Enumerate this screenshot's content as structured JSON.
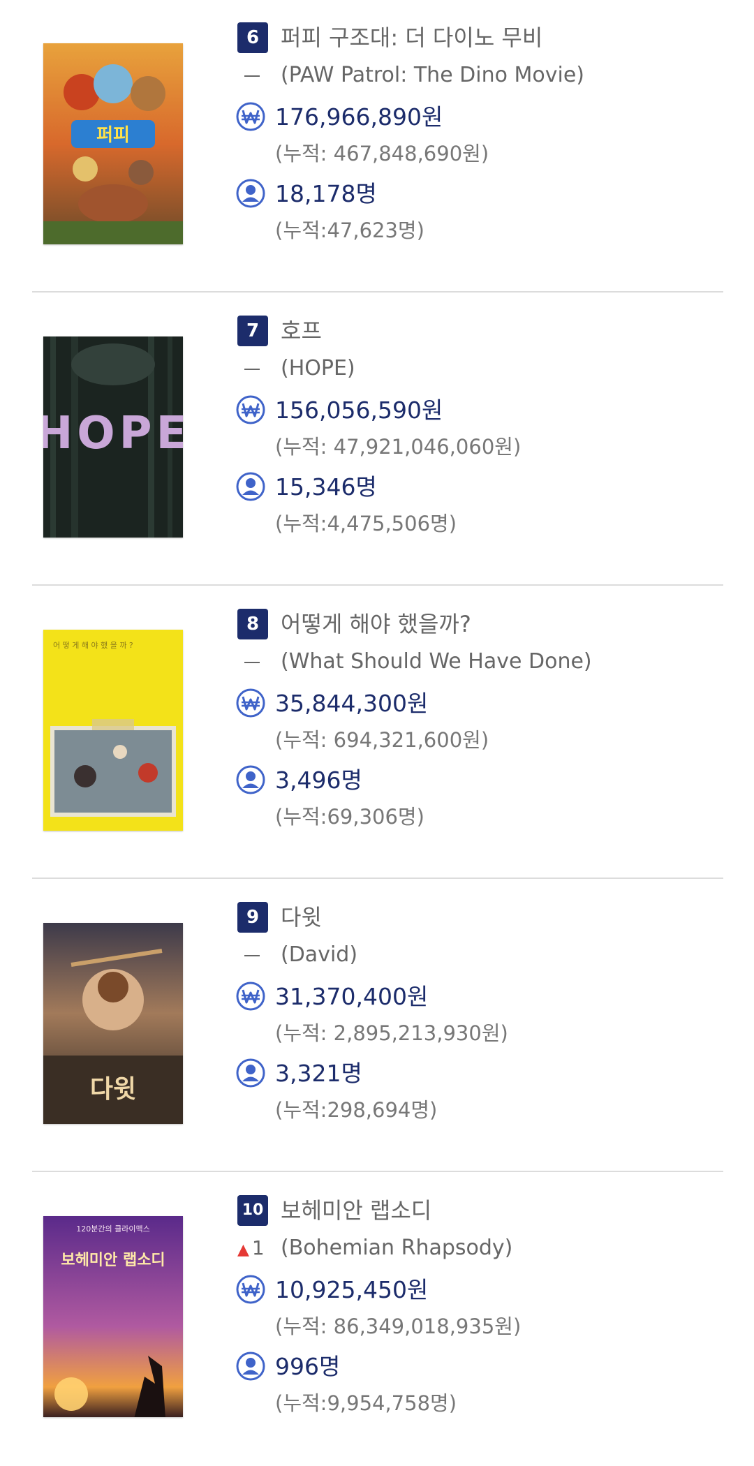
{
  "movies": [
    {
      "rank": "6",
      "title": "퍼피 구조대: 더 다이노 무비",
      "original_title": "(PAW Patrol: The Dino Movie)",
      "rank_change": {
        "type": "same",
        "value": ""
      },
      "sales": "176,966,890원",
      "sales_cumulative": "(누적: 467,848,690원)",
      "audience": "18,178명",
      "audience_cumulative": "(누적:47,623명)",
      "poster_text": "퍼피"
    },
    {
      "rank": "7",
      "title": "호프",
      "original_title": "(HOPE)",
      "rank_change": {
        "type": "same",
        "value": ""
      },
      "sales": "156,056,590원",
      "sales_cumulative": "(누적: 47,921,046,060원)",
      "audience": "15,346명",
      "audience_cumulative": "(누적:4,475,506명)",
      "poster_text": "HOPE"
    },
    {
      "rank": "8",
      "title": "어떻게 해야 했을까?",
      "original_title": "(What Should We Have Done)",
      "rank_change": {
        "type": "same",
        "value": ""
      },
      "sales": "35,844,300원",
      "sales_cumulative": "(누적: 694,321,600원)",
      "audience": "3,496명",
      "audience_cumulative": "(누적:69,306명)",
      "poster_text": "어 떻 게 해 야 했 을 까 ?"
    },
    {
      "rank": "9",
      "title": "다윗",
      "original_title": "(David)",
      "rank_change": {
        "type": "same",
        "value": ""
      },
      "sales": "31,370,400원",
      "sales_cumulative": "(누적: 2,895,213,930원)",
      "audience": "3,321명",
      "audience_cumulative": "(누적:298,694명)",
      "poster_text": "다윗"
    },
    {
      "rank": "10",
      "title": "보헤미안 랩소디",
      "original_title": "(Bohemian Rhapsody)",
      "rank_change": {
        "type": "up",
        "value": "1"
      },
      "sales": "10,925,450원",
      "sales_cumulative": "(누적: 86,349,018,935원)",
      "audience": "996명",
      "audience_cumulative": "(누적:9,954,758명)",
      "poster_text": "보헤미안 랩소디",
      "poster_tagline": "120분간의 클라이맥스"
    }
  ],
  "icons": {
    "sales": "won-icon",
    "audience": "person-icon",
    "rank_up": "arrow-up-icon",
    "rank_same": "dash-icon"
  },
  "colors": {
    "rank_badge": "#1c2c6b",
    "value_text": "#1c2c6b",
    "icon": "#3f63c9",
    "rank_up": "#e53935"
  }
}
